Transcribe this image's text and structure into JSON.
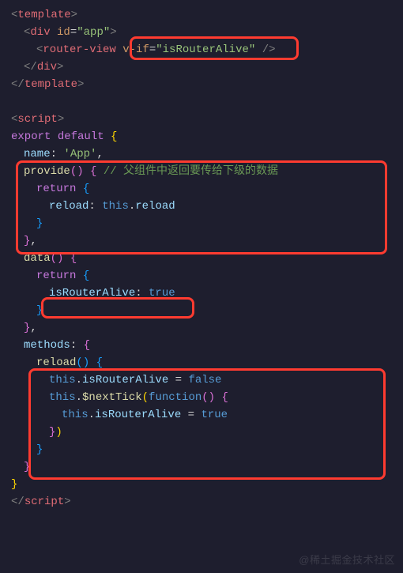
{
  "code": {
    "tpl": {
      "open": "template",
      "div": "div",
      "idAttr": "id",
      "idVal": "\"app\"",
      "rv": "router-view",
      "vif": "v-if",
      "vifVal": "\"isRouterAlive\"",
      "divClose": "div",
      "close": "template"
    },
    "script": {
      "open": "script",
      "exp": "export",
      "dft": "default",
      "nameKey": "name",
      "nameVal": "'App'",
      "provide": "provide",
      "cmnt": "// 父组件中返回要传给下级的数据",
      "ret1": "return",
      "reloadKey": "reload",
      "thisKw": "this",
      "reloadRef": "reload",
      "data": "data",
      "ret2": "return",
      "isRA": "isRouterAlive",
      "trueVal": "true",
      "methods": "methods",
      "reloadFn": "reload",
      "this1": "this",
      "ira1": "isRouterAlive",
      "eq1": " = ",
      "falseVal": "false",
      "this2": "this",
      "nextTick": "$nextTick",
      "fnKw": "function",
      "this3": "this",
      "ira2": "isRouterAlive",
      "eq2": " = ",
      "trueVal2": "true",
      "close": "script"
    }
  },
  "watermark": "@稀土掘金技术社区"
}
